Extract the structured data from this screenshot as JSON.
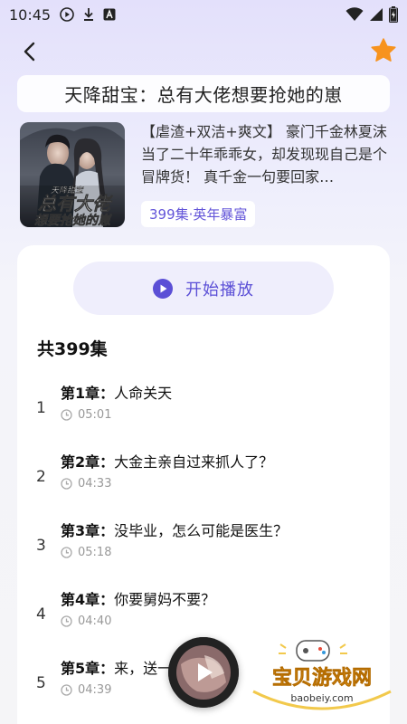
{
  "status_bar": {
    "time": "10:45"
  },
  "nav": {
    "back_icon": "chevron-left-icon",
    "favorite_icon": "star-icon",
    "favorite_color": "#f7931e"
  },
  "drama": {
    "title": "天降甜宝：总有大佬想要抢她的崽",
    "description": "【虐渣+双洁+爽文】 豪门千金林夏沫当了二十年乖乖女，却发现现自己是个冒牌货！ 真千金一句要回家…",
    "tag": "399集·英年暴富",
    "cover_text_top": "天降甜宝",
    "cover_text_mid": "总有大佬",
    "cover_text_bottom": "想要抢她的崽"
  },
  "player": {
    "play_label": "开始播放",
    "accent": "#5b4fd6"
  },
  "episodes": {
    "count_label": "共399集",
    "items": [
      {
        "num": "1",
        "chapter": "第1章：",
        "title": "人命关天",
        "duration": "05:01"
      },
      {
        "num": "2",
        "chapter": "第2章：",
        "title": "大金主亲自过来抓人了？",
        "duration": "04:33"
      },
      {
        "num": "3",
        "chapter": "第3章：",
        "title": "没毕业，怎么可能是医生？",
        "duration": "05:18"
      },
      {
        "num": "4",
        "chapter": "第4章：",
        "title": "你要舅妈不要？",
        "duration": "04:40"
      },
      {
        "num": "5",
        "chapter": "第5章：",
        "title": "来，送一…给你们",
        "duration": "04:39"
      }
    ]
  },
  "watermark": {
    "text": "宝贝游戏网",
    "url": "baobeiy.com"
  }
}
